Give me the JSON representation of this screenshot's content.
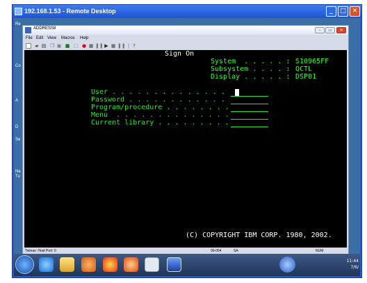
{
  "rdp": {
    "title": "192.168.1.53 - Remote Desktop",
    "desktop_labels": [
      "Re",
      "Co",
      "A",
      "D",
      "Se",
      "Ne",
      "Tu"
    ]
  },
  "emulator": {
    "title": "ADDRESS8",
    "menu": [
      "File",
      "Edit",
      "View",
      "Macros",
      "Help"
    ],
    "status": {
      "host_port": "Twinax: Host Port: 0",
      "position": "06-054",
      "mode": "SA",
      "num": "NUM"
    }
  },
  "signon": {
    "heading": "Sign On",
    "system_label": "System  . . . . . :",
    "system_value": "S10965FF",
    "subsystem_label": "Subsystem . . . . :",
    "subsystem_value": "QCTL",
    "display_label": "Display . . . . . :",
    "display_value": "DSP01",
    "fields": [
      {
        "label": "User . . . . . . . . . . . . . ."
      },
      {
        "label": "Password . . . . . . . . . . . ."
      },
      {
        "label": "Program/procedure . . . . . . . ."
      },
      {
        "label": "Menu  . . . . . . . . . . . . . ."
      },
      {
        "label": "Current library . . . . . . . . ."
      }
    ],
    "copyright": "(C) COPYRIGHT IBM CORP. 1980, 2002."
  },
  "taskbar": {
    "clock_time": "11:44",
    "clock_date": "7/6/"
  },
  "colors": {
    "terminal_bg": "#000000",
    "terminal_green": "#33ff33",
    "terminal_white": "#ffffff",
    "rdp_blue": "#2459d1"
  }
}
